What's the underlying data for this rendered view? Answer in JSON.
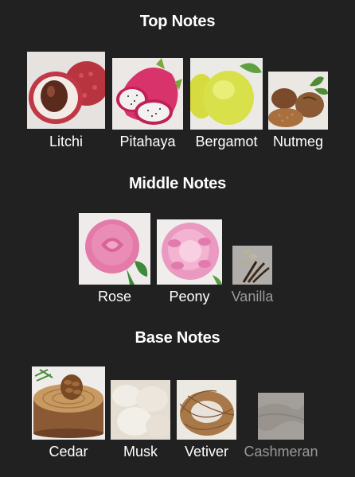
{
  "sections": [
    {
      "title": "Top Notes",
      "notes": [
        {
          "name": "Litchi",
          "icon": "litchi-icon"
        },
        {
          "name": "Pitahaya",
          "icon": "pitahaya-icon"
        },
        {
          "name": "Bergamot",
          "icon": "bergamot-icon"
        },
        {
          "name": "Nutmeg",
          "icon": "nutmeg-icon"
        }
      ]
    },
    {
      "title": "Middle Notes",
      "notes": [
        {
          "name": "Rose",
          "icon": "rose-icon"
        },
        {
          "name": "Peony",
          "icon": "peony-icon"
        },
        {
          "name": "Vanilla",
          "icon": "vanilla-icon"
        }
      ]
    },
    {
      "title": "Base Notes",
      "notes": [
        {
          "name": "Cedar",
          "icon": "cedar-icon"
        },
        {
          "name": "Musk",
          "icon": "musk-icon"
        },
        {
          "name": "Vetiver",
          "icon": "vetiver-icon"
        },
        {
          "name": "Cashmeran",
          "icon": "cashmeran-icon"
        }
      ]
    }
  ],
  "colors": {
    "background": "#212121",
    "text": "#ffffff",
    "faded_text": "#9a9a9a"
  }
}
